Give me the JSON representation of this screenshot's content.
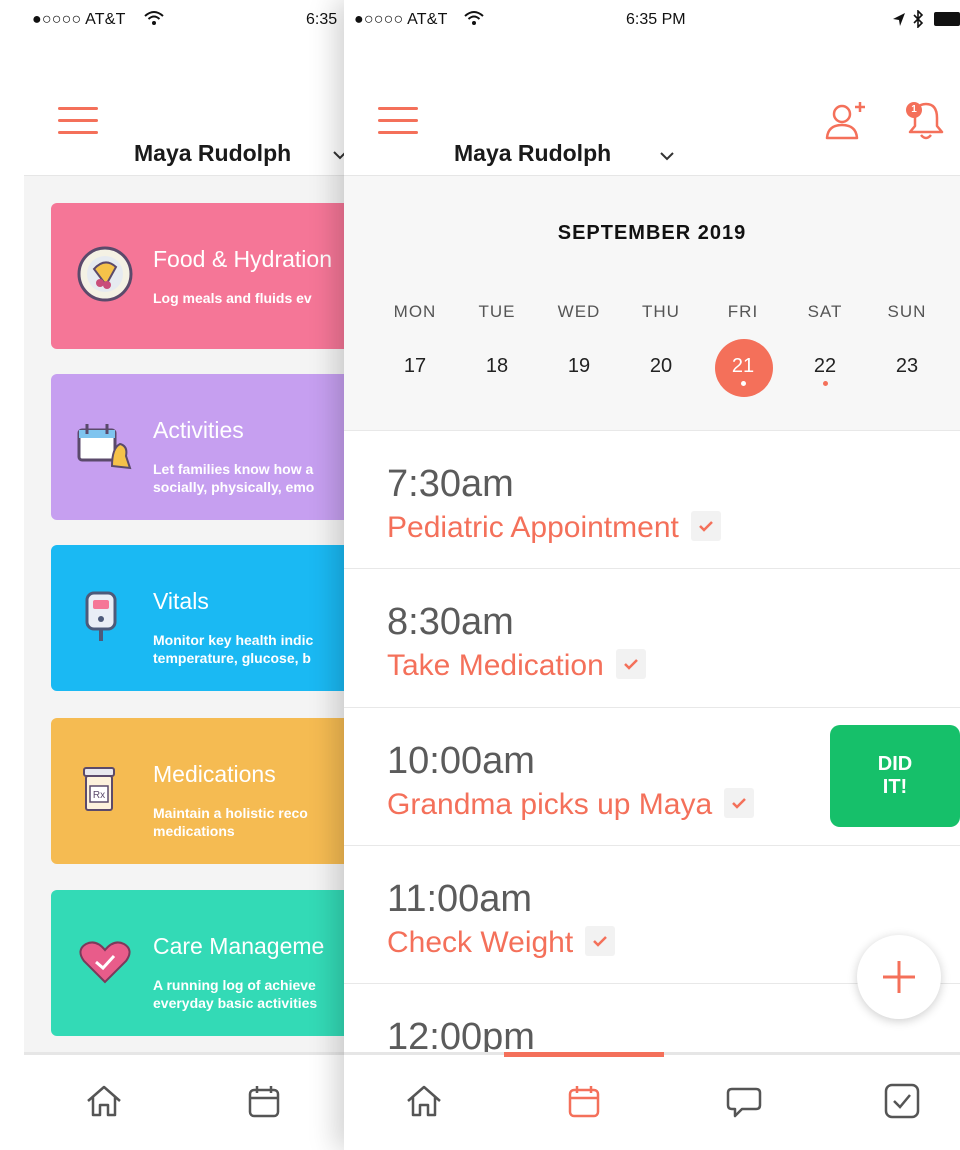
{
  "back_screen": {
    "status": {
      "carrier": "●○○○○ AT&T",
      "time": "6:35"
    },
    "nav": {
      "user_name": "Maya Rudolph"
    },
    "cards": [
      {
        "title": "Food & Hydration",
        "description": "Log meals and fluids ev",
        "color": "#f57697",
        "icon": "food-plate-icon"
      },
      {
        "title": "Activities",
        "description": "Let families know how a\nsocially, physically, emo",
        "color": "#c69ff0",
        "icon": "calendar-chess-icon"
      },
      {
        "title": "Vitals",
        "description": "Monitor key health indic\ntemperature, glucose, b",
        "color": "#1ab9f3",
        "icon": "glucose-meter-icon"
      },
      {
        "title": "Medications",
        "description": "Maintain a holistic reco\nmedications",
        "color": "#f5bb52",
        "icon": "pill-bottle-icon"
      },
      {
        "title": "Care Manageme",
        "description": "A running log of achieve\neveryday basic activities",
        "color": "#33dab6",
        "icon": "heart-icon"
      }
    ],
    "tabbar": [
      "home-icon",
      "calendar-icon"
    ]
  },
  "front_screen": {
    "status": {
      "carrier": "●○○○○ AT&T",
      "time": "6:35 PM"
    },
    "nav": {
      "user_name": "Maya Rudolph",
      "notification_count": "1"
    },
    "calendar": {
      "month": "SEPTEMBER 2019",
      "weekdays": [
        "MON",
        "TUE",
        "WED",
        "THU",
        "FRI",
        "SAT",
        "SUN"
      ],
      "days": [
        "17",
        "18",
        "19",
        "20",
        "21",
        "22",
        "23"
      ],
      "selected_day": "21",
      "days_with_events": [
        "21",
        "22"
      ]
    },
    "events": [
      {
        "time": "7:30am",
        "name": "Pediatric Appointment"
      },
      {
        "time": "8:30am",
        "name": "Take Medication"
      },
      {
        "time": "10:00am",
        "name": "Grandma picks up Maya"
      },
      {
        "time": "11:00am",
        "name": "Check Weight"
      },
      {
        "time": "12:00pm",
        "name": ""
      }
    ],
    "did_it": {
      "line1": "DID",
      "line2": "IT!"
    },
    "tabbar": [
      "home-icon",
      "calendar-icon",
      "chat-icon",
      "checklist-icon"
    ],
    "active_tab": "calendar-icon"
  },
  "colors": {
    "accent": "#f4705a",
    "success": "#16c06a"
  }
}
